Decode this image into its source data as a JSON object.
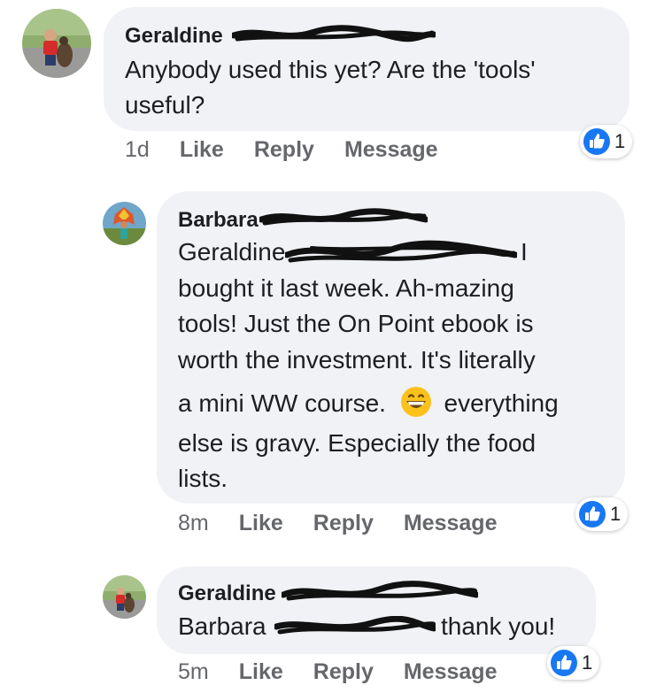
{
  "comments": [
    {
      "name": "Geraldine",
      "lines": [
        "Anybody used this yet? Are the 'tools'",
        "useful?"
      ],
      "time": "1d",
      "like": "Like",
      "reply": "Reply",
      "message": "Message",
      "reaction_count": "1"
    },
    {
      "name": "Barbara",
      "mention": "Geraldine",
      "mention_suffix": "I",
      "lines": [
        "bought it last week. Ah-mazing",
        "tools! Just the On Point ebook is",
        "worth the investment. It's literally"
      ],
      "line_emoji_before": "a mini WW course.",
      "line_emoji_after": "everything",
      "lines_after": [
        "else is gravy. Especially the food",
        "lists."
      ],
      "emoji": "grinning-face",
      "time": "8m",
      "like": "Like",
      "reply": "Reply",
      "message": "Message",
      "reaction_count": "1"
    },
    {
      "name": "Geraldine",
      "mention": "Barbara",
      "text_after": "thank you!",
      "time": "5m",
      "like": "Like",
      "reply": "Reply",
      "message": "Message",
      "reaction_count": "1"
    }
  ],
  "colors": {
    "bubble": "#f0f2f5",
    "meta": "#65676b",
    "like_blue": "#1877f2"
  },
  "icons": [
    "avatar-geraldine",
    "avatar-barbara",
    "like-reaction-icon",
    "grinning-face-emoji"
  ]
}
